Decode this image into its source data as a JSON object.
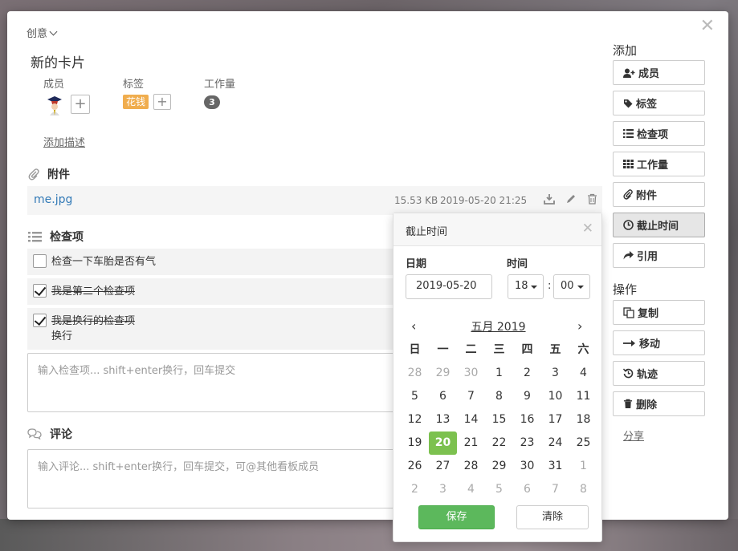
{
  "breadcrumb": {
    "board": "创意"
  },
  "card": {
    "title": "新的卡片",
    "members_label": "成员",
    "tags_label": "标签",
    "workload_label": "工作量",
    "tag": "花钱",
    "workload": "3",
    "add_description": "添加描述"
  },
  "attachments": {
    "heading": "附件",
    "items": [
      {
        "name": "me.jpg",
        "size": "15.53 KB",
        "time": "2019-05-20 21:25"
      }
    ]
  },
  "checklist": {
    "heading": "检查项",
    "items": [
      {
        "text": "检查一下车胎是否有气",
        "done": false
      },
      {
        "text": "我是第二个检查项",
        "done": true
      },
      {
        "line1": "我是换行的检查项",
        "line2": "换行",
        "done": true
      }
    ],
    "placeholder": "输入检查项... shift+enter换行，回车提交"
  },
  "comments": {
    "heading": "评论",
    "placeholder": "输入评论... shift+enter换行，回车提交，可@其他看板成员"
  },
  "sidebar": {
    "add_heading": "添加",
    "add_buttons": [
      "成员",
      "标签",
      "检查项",
      "工作量",
      "附件",
      "截止时间",
      "引用"
    ],
    "actions_heading": "操作",
    "action_buttons": [
      "复制",
      "移动",
      "轨迹",
      "删除"
    ],
    "share": "分享"
  },
  "due_popover": {
    "title": "截止时间",
    "date_label": "日期",
    "time_label": "时间",
    "date_value": "2019-05-20",
    "hour": "18",
    "minute": "00",
    "colon": ":",
    "month_label": "五月 2019",
    "weekdays": [
      "日",
      "一",
      "二",
      "三",
      "四",
      "五",
      "六"
    ],
    "weeks": [
      [
        "28",
        "29",
        "30",
        "1",
        "2",
        "3",
        "4"
      ],
      [
        "5",
        "6",
        "7",
        "8",
        "9",
        "10",
        "11"
      ],
      [
        "12",
        "13",
        "14",
        "15",
        "16",
        "17",
        "18"
      ],
      [
        "19",
        "20",
        "21",
        "22",
        "23",
        "24",
        "25"
      ],
      [
        "26",
        "27",
        "28",
        "29",
        "30",
        "31",
        "1"
      ],
      [
        "2",
        "3",
        "4",
        "5",
        "6",
        "7",
        "8"
      ]
    ],
    "selected": "20",
    "save": "保存",
    "clear": "清除"
  },
  "colors": {
    "accent": "#5cb85c",
    "selected_day": "#7cc14f",
    "tag": "#f0ad4e",
    "link": "#337ab7"
  }
}
